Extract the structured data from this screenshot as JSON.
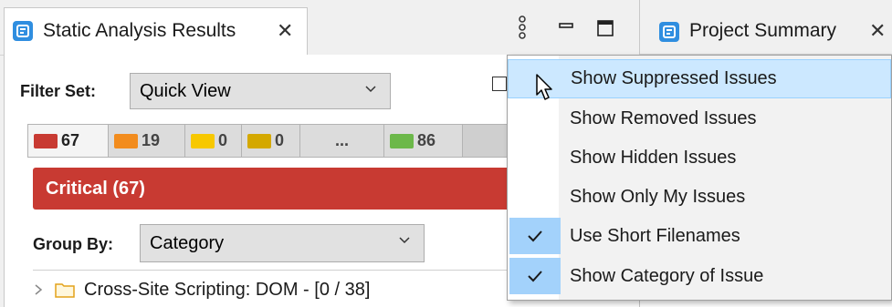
{
  "left_view": {
    "tab_title": "Static Analysis Results",
    "filter_set_label": "Filter Set:",
    "filter_set_value": "Quick View",
    "priority_tabs": [
      {
        "count": "67",
        "color": "#c83a32"
      },
      {
        "count": "19",
        "color": "#f28c1e"
      },
      {
        "count": "0",
        "color": "#f7c800"
      },
      {
        "count": "0",
        "color": "#d4a800"
      },
      {
        "count": "...",
        "color": ""
      },
      {
        "count": "86",
        "color": "#6cb84a"
      }
    ],
    "active_priority": "Critical (67)",
    "group_by_label": "Group By:",
    "group_by_value": "Category",
    "tree_item": "Cross-Site Scripting: DOM - [0 / 38]"
  },
  "right_view": {
    "tab_title": "Project Summary"
  },
  "menu": {
    "items": [
      {
        "label": "Show Suppressed Issues",
        "checked": false,
        "highlighted": true
      },
      {
        "label": "Show Removed Issues",
        "checked": false
      },
      {
        "label": "Show Hidden Issues",
        "checked": false
      },
      {
        "label": "Show Only My Issues",
        "checked": false
      },
      {
        "label": "Use Short Filenames",
        "checked": true
      },
      {
        "label": "Show Category of Issue",
        "checked": true
      }
    ]
  },
  "colors": {
    "accent": "#2f8ee0",
    "critical": "#c83a32",
    "menu_highlight": "#cce8ff",
    "check_background": "#a3d2fb"
  },
  "icons": [
    "view-icon",
    "close-icon",
    "view-menu-icon",
    "minimize-icon",
    "maximize-icon",
    "chevron-down-icon",
    "checkmark-icon",
    "folder-icon",
    "expand-arrow-icon",
    "mouse-pointer-icon"
  ]
}
